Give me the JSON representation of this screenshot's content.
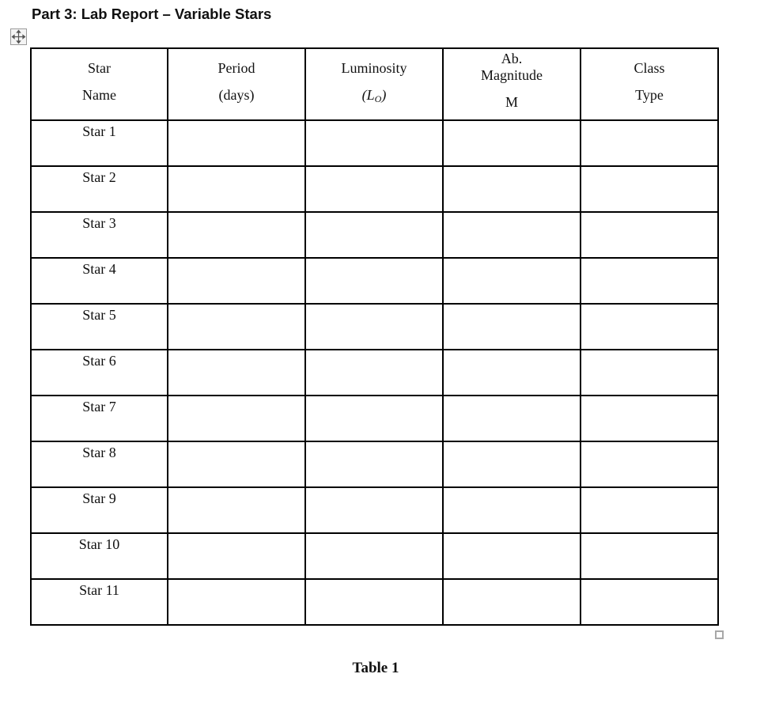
{
  "document": {
    "heading": "Part 3: Lab Report – Variable Stars",
    "caption": "Table 1"
  },
  "table": {
    "headers": {
      "star_name": [
        "Star",
        "Name"
      ],
      "period": [
        "Period",
        "(days)"
      ],
      "luminosity": [
        "Luminosity",
        "(L",
        "O",
        ")"
      ],
      "magnitude": [
        "Ab.",
        "Magnitude",
        "M"
      ],
      "class_type": [
        "Class",
        "Type"
      ]
    },
    "rows": [
      {
        "name": "Star 1",
        "period": "",
        "luminosity": "",
        "magnitude": "",
        "class_type": ""
      },
      {
        "name": "Star 2",
        "period": "",
        "luminosity": "",
        "magnitude": "",
        "class_type": ""
      },
      {
        "name": "Star 3",
        "period": "",
        "luminosity": "",
        "magnitude": "",
        "class_type": ""
      },
      {
        "name": "Star 4",
        "period": "",
        "luminosity": "",
        "magnitude": "",
        "class_type": ""
      },
      {
        "name": "Star 5",
        "period": "",
        "luminosity": "",
        "magnitude": "",
        "class_type": ""
      },
      {
        "name": "Star 6",
        "period": "",
        "luminosity": "",
        "magnitude": "",
        "class_type": ""
      },
      {
        "name": "Star 7",
        "period": "",
        "luminosity": "",
        "magnitude": "",
        "class_type": ""
      },
      {
        "name": "Star 8",
        "period": "",
        "luminosity": "",
        "magnitude": "",
        "class_type": ""
      },
      {
        "name": "Star 9",
        "period": "",
        "luminosity": "",
        "magnitude": "",
        "class_type": ""
      },
      {
        "name": "Star 10",
        "period": "",
        "luminosity": "",
        "magnitude": "",
        "class_type": ""
      },
      {
        "name": "Star 11",
        "period": "",
        "luminosity": "",
        "magnitude": "",
        "class_type": ""
      }
    ]
  },
  "icons": {
    "move_handle": "move-arrows-icon",
    "resize_handle": "resize-handle-icon"
  }
}
